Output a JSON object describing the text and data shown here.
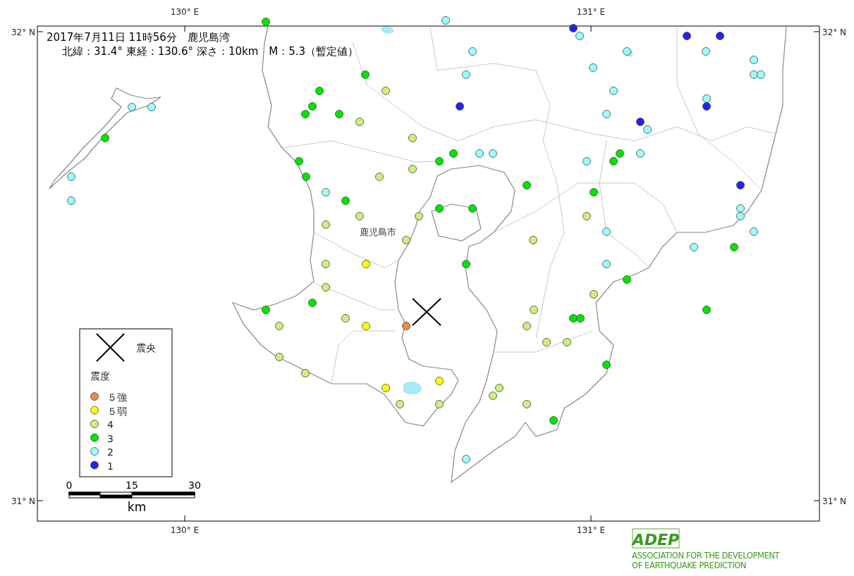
{
  "map": {
    "header": {
      "line_1": "2017年7月11日 11時56分　鹿児島湾",
      "line_2": "北緯：31.4°  東経：130.6°  深さ：10km　M：5.3（暫定値）"
    },
    "axis_labels": {
      "top": [
        "130° E",
        "131° E"
      ],
      "bottom": [
        "130° E",
        "131° E"
      ],
      "left": [
        "32° N",
        "31° N"
      ],
      "right": [
        "32° N",
        "31° N"
      ]
    },
    "city_label": "鹿児島市",
    "stations": [
      {
        "color": "#00e600"
      },
      {
        "color": "#99ffff"
      },
      {
        "color": "#2222ee"
      },
      {
        "color": "#99ffff"
      },
      {
        "color": "#2222ee"
      },
      {
        "color": "#2222ee"
      },
      {
        "color": "#99ffff"
      },
      {
        "color": "#99ffff"
      },
      {
        "color": "#99ffff"
      },
      {
        "color": "#99ffff"
      },
      {
        "color": "#99ffff"
      },
      {
        "color": "#99ffff"
      },
      {
        "color": "#99ffff"
      },
      {
        "color": "#00e600"
      },
      {
        "color": "#99ffff"
      },
      {
        "color": "#00e600"
      },
      {
        "color": "#ccf07a"
      },
      {
        "color": "#99ffff"
      },
      {
        "color": "#99ffff"
      },
      {
        "color": "#99ffff"
      },
      {
        "color": "#00e600"
      },
      {
        "color": "#00e600"
      },
      {
        "color": "#00e600"
      },
      {
        "color": "#2222ee"
      },
      {
        "color": "#99ffff"
      },
      {
        "color": "#2222ee"
      },
      {
        "color": "#99ffff"
      },
      {
        "color": "#2222ee"
      },
      {
        "color": "#99ffff"
      },
      {
        "color": "#ccf07a"
      },
      {
        "color": "#ccf07a"
      },
      {
        "color": "#00e600"
      },
      {
        "color": "#00e600"
      },
      {
        "color": "#99ffff"
      },
      {
        "color": "#99ffff"
      },
      {
        "color": "#00e600"
      },
      {
        "color": "#99ffff"
      },
      {
        "color": "#00e600"
      },
      {
        "color": "#00e600"
      },
      {
        "color": "#99ffff"
      },
      {
        "color": "#00e600"
      },
      {
        "color": "#ccf07a"
      },
      {
        "color": "#99ffff"
      },
      {
        "color": "#00e600"
      },
      {
        "color": "#ccf07a"
      },
      {
        "color": "#00e600"
      },
      {
        "color": "#2222ee"
      },
      {
        "color": "#99ffff"
      },
      {
        "color": "#00e600"
      },
      {
        "color": "#00e600"
      },
      {
        "color": "#99ffff"
      },
      {
        "color": "#00e600"
      },
      {
        "color": "#00e600"
      },
      {
        "color": "#99ffff"
      },
      {
        "color": "#99ffff"
      },
      {
        "color": "#ccf07a"
      },
      {
        "color": "#ccf07a"
      },
      {
        "color": "#ccf07a"
      },
      {
        "color": "#ccf07a"
      },
      {
        "color": "#99ffff"
      },
      {
        "color": "#99ffff"
      },
      {
        "color": "#ccf07a"
      },
      {
        "color": "#ccf07a"
      },
      {
        "color": "#99ffff"
      },
      {
        "color": "#00e600"
      },
      {
        "color": "#ccf07a"
      },
      {
        "color": "#ffff00"
      },
      {
        "color": "#00e600"
      },
      {
        "color": "#99ffff"
      },
      {
        "color": "#00e600"
      },
      {
        "color": "#ccf07a"
      },
      {
        "color": "#ccf07a"
      },
      {
        "color": "#00e600"
      },
      {
        "color": "#00e600"
      },
      {
        "color": "#ccf07a"
      },
      {
        "color": "#00e600"
      },
      {
        "color": "#ccf07a"
      },
      {
        "color": "#00e600"
      },
      {
        "color": "#00e600"
      },
      {
        "color": "#ccf07a"
      },
      {
        "color": "#ffff00"
      },
      {
        "color": "#f08a3c"
      },
      {
        "color": "#ccf07a"
      },
      {
        "color": "#ccf07a"
      },
      {
        "color": "#ccf07a"
      },
      {
        "color": "#ccf07a"
      },
      {
        "color": "#00e600"
      },
      {
        "color": "#ccf07a"
      },
      {
        "color": "#ffff00"
      },
      {
        "color": "#ffff00"
      },
      {
        "color": "#ccf07a"
      },
      {
        "color": "#ccf07a"
      },
      {
        "color": "#ccf07a"
      },
      {
        "color": "#ccf07a"
      },
      {
        "color": "#ccf07a"
      },
      {
        "color": "#00e600"
      },
      {
        "color": "#99ffff"
      }
    ],
    "legend": {
      "epicenter_label": "震央",
      "intensity_title": "震度",
      "items": [
        {
          "label": "５強",
          "color": "#f08a3c"
        },
        {
          "label": "５弱",
          "color": "#ffff00"
        },
        {
          "label": "4",
          "color": "#ccf07a"
        },
        {
          "label": "3",
          "color": "#00e600"
        },
        {
          "label": "2",
          "color": "#99ffff"
        },
        {
          "label": "1",
          "color": "#2222ee"
        }
      ]
    },
    "scale_bar": {
      "ticks": [
        "0",
        "15",
        "30"
      ],
      "unit": "km"
    }
  },
  "logo": {
    "mark": "ADEP",
    "lines": [
      "ASSOCIATION  FOR THE DEVELOPMENT",
      "OF EARTHQUAKE PREDICTION"
    ]
  }
}
